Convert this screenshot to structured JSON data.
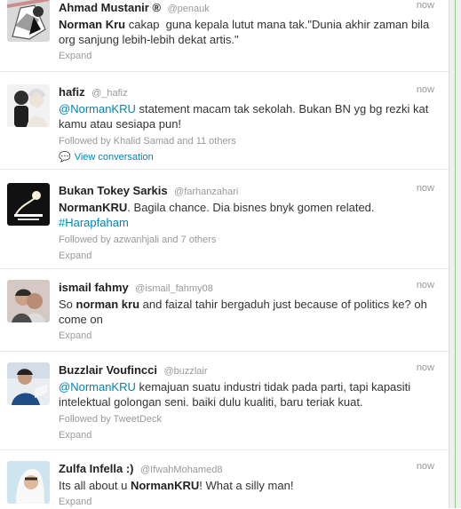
{
  "tweets": [
    {
      "id": "1",
      "name": "Ahmad Mustanir ®",
      "handle": "@penauk",
      "time": "now",
      "text": {
        "part_a": "Norman Kru",
        "part_b": " cakap  guna kepala lutut mana tak.\"Dunia akhir zaman bila org sanjung lebih-lebih dekat artis.\""
      },
      "expand": "Expand"
    },
    {
      "id": "2",
      "name": "hafiz",
      "handle": "@_hafiz",
      "time": "now",
      "text": {
        "part_a": "@NormanKRU",
        "part_b": " statement macam tak sekolah. Bukan BN yg bg rezki kat kamu atau sesiapa pun!"
      },
      "followed_by": "Followed by Khalid Samad and 11 others",
      "view_conversation": "View conversation"
    },
    {
      "id": "3",
      "name": "Bukan Tokey Sarkis",
      "handle": "@farhanzahari",
      "time": "now",
      "text": {
        "part_a": "NormanKRU",
        "part_b": ". Bagila chance. Dia bisnes bnyk gomen related.",
        "hashtag": "#Harapfaham"
      },
      "followed_by": "Followed by azwanhjali and 7 others",
      "expand": "Expand"
    },
    {
      "id": "4",
      "name": "ismail fahmy",
      "handle": "@ismail_fahmy08",
      "time": "now",
      "text": {
        "part_a": "So ",
        "part_b": "norman kru",
        "part_c": " and faizal tahir bergaduh just because of politics ke? oh come on"
      },
      "expand": "Expand"
    },
    {
      "id": "5",
      "name": "Buzzlair Voufincci",
      "handle": "@buzzlair",
      "time": "now",
      "text": {
        "part_a": "@NormanKRU",
        "part_b": " kemajuan suatu industri tidak pada parti, tapi kapasiti intelektual golongan seni. baiki dulu kualiti, baru teriak kuat."
      },
      "followed_by": "Followed by TweetDeck",
      "expand": "Expand"
    },
    {
      "id": "6",
      "name": "Zulfa Infella :)",
      "handle": "@IfwahMohamed8",
      "time": "now",
      "text": {
        "part_a": "Its all about u ",
        "part_b": "NormanKRU",
        "part_c": "! What a silly man!"
      },
      "expand": "Expand"
    }
  ],
  "colors": {
    "link": "#0084b4",
    "muted": "#999999",
    "text": "#333333",
    "name": "#222222"
  },
  "icons": {
    "conversation": "speech-bubble-icon"
  }
}
